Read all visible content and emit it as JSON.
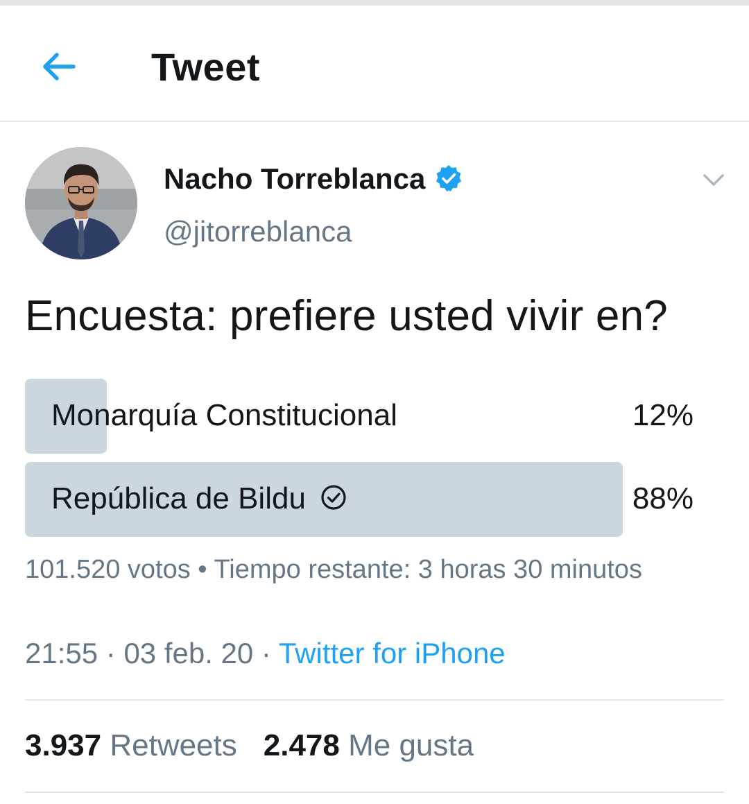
{
  "header": {
    "title": "Tweet",
    "back_icon": "arrow-left-icon",
    "accent_color": "#1da1f2"
  },
  "tweet": {
    "author": {
      "name": "Nacho Torreblanca",
      "handle": "@jitorreblanca",
      "verified": true
    },
    "text": "Encuesta: prefiere usted vivir en?",
    "poll": {
      "options": [
        {
          "label": "Monarquía Constitucional",
          "percent_label": "12%",
          "percent": 12,
          "selected": false
        },
        {
          "label": "República de Bildu",
          "percent_label": "88%",
          "percent": 88,
          "selected": true
        }
      ],
      "meta": "101.520 votos • Tiempo restante: 3 horas 30 minutos",
      "bar_color": "#ccd6dd"
    },
    "time": "21:55",
    "date": "03 feb. 20",
    "separator": " · ",
    "source": "Twitter for iPhone",
    "stats": {
      "retweets_count": "3.937",
      "retweets_label": "Retweets",
      "likes_count": "2.478",
      "likes_label": "Me gusta"
    }
  }
}
